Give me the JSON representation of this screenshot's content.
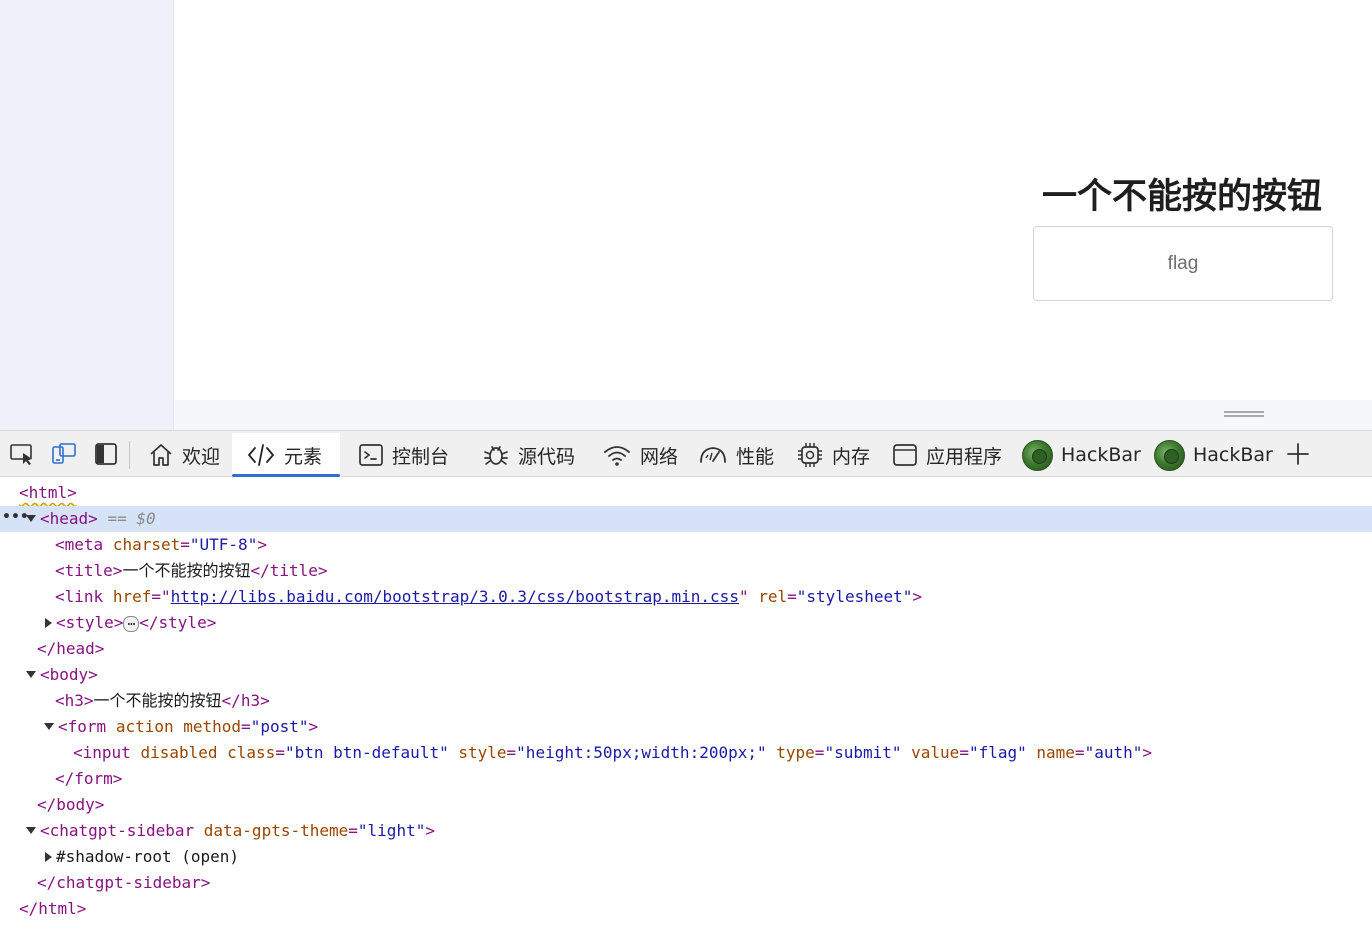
{
  "page": {
    "heading": "一个不能按的按钮",
    "button_value": "flag"
  },
  "devtools": {
    "tabs": [
      {
        "label": "欢迎",
        "icon": "home-icon"
      },
      {
        "label": "元素",
        "icon": "code-icon",
        "active": true
      },
      {
        "label": "控制台",
        "icon": "console-icon"
      },
      {
        "label": "源代码",
        "icon": "bug-icon"
      },
      {
        "label": "网络",
        "icon": "wifi-icon"
      },
      {
        "label": "性能",
        "icon": "gauge-icon"
      },
      {
        "label": "内存",
        "icon": "chip-icon"
      },
      {
        "label": "应用程序",
        "icon": "window-icon"
      },
      {
        "label": "HackBar",
        "icon": "hackbar-icon"
      },
      {
        "label": "HackBar",
        "icon": "hackbar-icon"
      }
    ],
    "accent_color": "#2f6fcf"
  },
  "dom": {
    "html_open": "<html>",
    "head_open": "<head>",
    "selected_marker": "== $0",
    "meta_tag": "<meta",
    "meta_attr": "charset",
    "meta_val": "\"UTF-8\"",
    "title_open": "<title>",
    "title_text": "一个不能按的按钮",
    "title_close": "</title>",
    "link_tag": "<link",
    "link_href_attr": "href",
    "link_href_val": "http://libs.baidu.com/bootstrap/3.0.3/css/bootstrap.min.css",
    "link_rel_attr": "rel",
    "link_rel_val": "\"stylesheet\"",
    "style_open": "<style>",
    "style_dots": "…",
    "style_close": "</style>",
    "head_close": "</head>",
    "body_open": "<body>",
    "h3_open": "<h3>",
    "h3_text": "一个不能按的按钮",
    "h3_close": "</h3>",
    "form_tag": "<form",
    "form_attr1": "action",
    "form_attr2": "method",
    "form_attr2_val": "\"post\"",
    "input_tag": "<input",
    "input_attr_disabled": "disabled",
    "input_attr_class": "class",
    "input_class_val": "\"btn btn-default\"",
    "input_attr_style": "style",
    "input_style_val": "\"height:50px;width:200px;\"",
    "input_attr_type": "type",
    "input_type_val": "\"submit\"",
    "input_attr_value": "value",
    "input_value_val": "\"flag\"",
    "input_attr_name": "name",
    "input_name_val": "\"auth\"",
    "form_close": "</form>",
    "body_close": "</body>",
    "sidebar_tag": "<chatgpt-sidebar",
    "sidebar_attr": "data-gpts-theme",
    "sidebar_val": "\"light\"",
    "shadow_root": "#shadow-root (open)",
    "sidebar_close": "</chatgpt-sidebar>",
    "html_close": "</html>"
  }
}
